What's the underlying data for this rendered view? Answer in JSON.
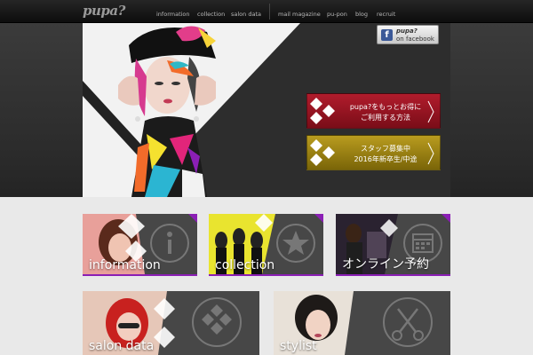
{
  "header": {
    "logo": "pupa?",
    "nav": [
      {
        "label": "information"
      },
      {
        "label": "collection"
      },
      {
        "label": "salon data"
      },
      {
        "label": "mail magazine"
      },
      {
        "label": "pu-pon"
      },
      {
        "label": "blog"
      },
      {
        "label": "recruit"
      }
    ]
  },
  "hero": {
    "facebook": {
      "line1": "pupa?",
      "line2": "on facebook"
    },
    "promo_member": {
      "line1": "pupa?をもっとお得に",
      "line2": "ご利用する方法"
    },
    "promo_recruit": {
      "line1": "スタッフ募集中",
      "line2": "2016年新卒生/中途"
    }
  },
  "tiles": {
    "information": {
      "label": "information",
      "icon": "info-icon"
    },
    "collection": {
      "label": "collection",
      "icon": "star-icon"
    },
    "reservation": {
      "label": "オンライン予約",
      "icon": "calendar-icon"
    },
    "salon_data": {
      "label": "salon data",
      "icon": "diamond-grid-icon"
    },
    "stylist": {
      "label": "stylist",
      "icon": "scissors-icon"
    }
  },
  "colors": {
    "accent": "#8b1fb5",
    "promo_red": "#9e1626",
    "promo_gold": "#a38a17",
    "facebook": "#3b5998"
  }
}
